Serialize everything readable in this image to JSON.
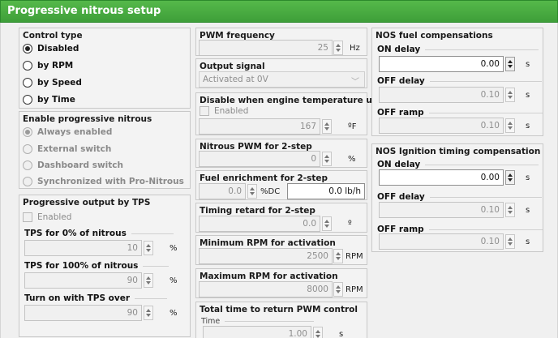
{
  "title": "Progressive nitrous setup",
  "control_type": {
    "title": "Control type",
    "options": [
      "Disabled",
      "by RPM",
      "by Speed",
      "by Time"
    ],
    "selected": "Disabled"
  },
  "enable_progressive": {
    "title": "Enable progressive nitrous",
    "options": [
      "Always enabled",
      "External switch",
      "Dashboard switch",
      "Synchronized with Pro-Nitrous"
    ],
    "selected": "Always enabled"
  },
  "progressive_tps": {
    "title": "Progressive output by TPS",
    "enabled_label": "Enabled",
    "tps0": {
      "label": "TPS for 0% of nitrous",
      "value": "10",
      "unit": "%"
    },
    "tps100": {
      "label": "TPS for 100% of nitrous",
      "value": "90",
      "unit": "%"
    },
    "turn_on": {
      "label": "Turn on with TPS over",
      "value": "90",
      "unit": "%"
    }
  },
  "pwm_frequency": {
    "title": "PWM frequency",
    "value": "25",
    "unit": "Hz"
  },
  "output_signal": {
    "title": "Output signal",
    "value": "Activated at 0V"
  },
  "disable_temp": {
    "title": "Disable when engine temperature under",
    "enabled_label": "Enabled",
    "value": "167",
    "unit": "ºF"
  },
  "nitrous_pwm_2step": {
    "title": "Nitrous PWM for 2-step",
    "value": "0",
    "unit": "%"
  },
  "fuel_enrichment": {
    "title": "Fuel enrichment for 2-step",
    "value": "0.0",
    "unit": "%DC",
    "value2": "0.0 lb/h"
  },
  "timing_retard": {
    "title": "Timing retard for 2-step",
    "value": "0.0",
    "unit": "º"
  },
  "min_rpm": {
    "title": "Minimum RPM for activation",
    "value": "2500",
    "unit": "RPM"
  },
  "max_rpm": {
    "title": "Maximum RPM for activation",
    "value": "8000",
    "unit": "RPM"
  },
  "total_time": {
    "title": "Total time to return PWM control",
    "sublabel": "Time",
    "value": "1.00",
    "unit": "s"
  },
  "fuel_comp": {
    "title": "NOS fuel compensations",
    "on_delay": {
      "label": "ON delay",
      "value": "0.00",
      "unit": "s"
    },
    "off_delay": {
      "label": "OFF delay",
      "value": "0.10",
      "unit": "s"
    },
    "off_ramp": {
      "label": "OFF ramp",
      "value": "0.10",
      "unit": "s"
    }
  },
  "ign_comp": {
    "title": "NOS Ignition timing compensation",
    "on_delay": {
      "label": "ON delay",
      "value": "0.00",
      "unit": "s"
    },
    "off_delay": {
      "label": "OFF delay",
      "value": "0.10",
      "unit": "s"
    },
    "off_ramp": {
      "label": "OFF ramp",
      "value": "0.10",
      "unit": "s"
    }
  }
}
